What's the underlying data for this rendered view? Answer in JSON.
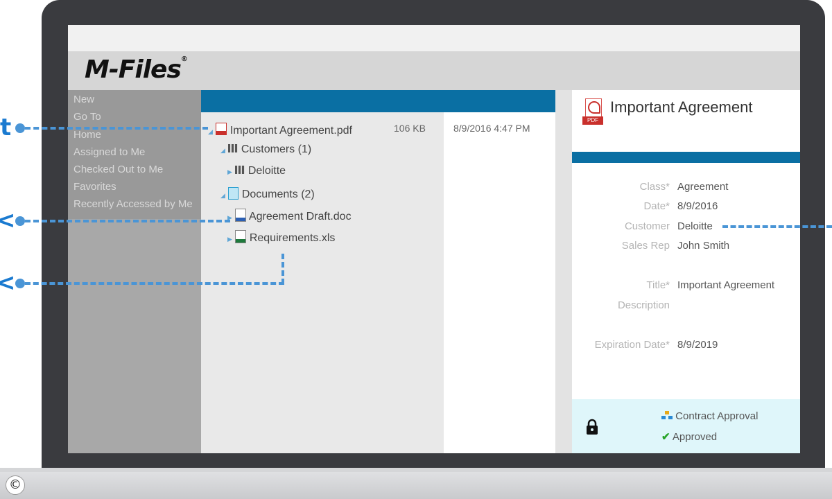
{
  "app": {
    "logo_text": "M-Files",
    "logo_mark": "®"
  },
  "sidebar": {
    "items": [
      {
        "label": "New"
      },
      {
        "label": "Go To"
      },
      {
        "label": "Home"
      },
      {
        "label": "Assigned to Me"
      },
      {
        "label": "Checked Out to Me"
      },
      {
        "label": "Favorites"
      },
      {
        "label": "Recently Accessed by Me"
      }
    ]
  },
  "tree": {
    "items": [
      {
        "label": "Important Agreement.pdf",
        "size": "106 KB",
        "date": "8/9/2016 4:47 PM",
        "icon": "pdf-icon"
      },
      {
        "label": "Customers (1)",
        "icon": "building-icon"
      },
      {
        "label": "Deloitte",
        "icon": "building-icon"
      },
      {
        "label": "Documents (2)",
        "icon": "document-stack-icon"
      },
      {
        "label": "Agreement Draft.doc",
        "icon": "word-doc-icon"
      },
      {
        "label": "Requirements.xls",
        "icon": "excel-doc-icon"
      }
    ]
  },
  "metadata": {
    "title": "Important Agreement",
    "pdf_badge": "PDF",
    "properties": [
      {
        "label": "Class*",
        "value": "Agreement"
      },
      {
        "label": "Date*",
        "value": "8/9/2016"
      },
      {
        "label": "Customer",
        "value": "Deloitte"
      },
      {
        "label": "Sales Rep",
        "value": "John Smith"
      },
      {
        "label": "Title*",
        "value": "Important Agreement"
      },
      {
        "label": "Description",
        "value": ""
      },
      {
        "label": "Expiration Date*",
        "value": "8/9/2019"
      }
    ]
  },
  "workflow": {
    "name": "Contract Approval",
    "state": "Approved",
    "lock_icon": "lock-icon",
    "workflow_icon": "workflow-icon",
    "state_icon": "checkmark-icon"
  },
  "edge_glyphs": {
    "top": "t",
    "middle": "<",
    "bottom": "<"
  },
  "copyright": "©",
  "colors": {
    "accent": "#0a6fa3",
    "callout": "#4a95d6",
    "workflow_bg": "#dff6fa",
    "check": "#27a327"
  }
}
